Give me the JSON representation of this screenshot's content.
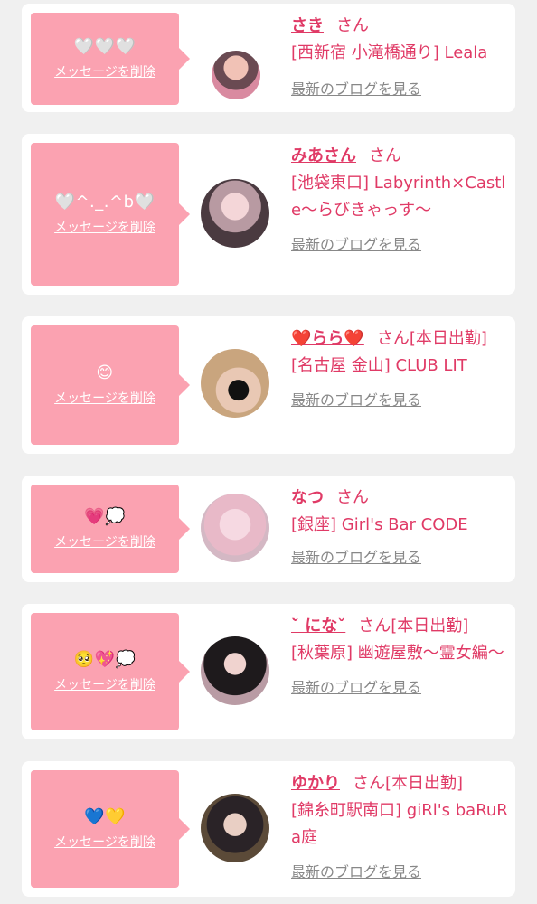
{
  "delete_label": "メッセージを削除",
  "blog_label": "最新のブログを見る",
  "san_label": "さん",
  "cards": [
    {
      "message": "🤍🤍🤍",
      "name": "さき",
      "suffix": "さん",
      "shop": "[西新宿 小滝橋通り] Leala"
    },
    {
      "message": "🤍^._.^b🤍",
      "name": "みあさん",
      "suffix": "さん",
      "shop": "[池袋東口] Labyrinth×Castle〜らびきゃっす〜"
    },
    {
      "message": "😊",
      "name": "❤️らら❤️",
      "suffix": "さん[本日出勤]",
      "shop": "[名古屋 金山] CLUB LIT"
    },
    {
      "message": "💗💭",
      "name": "なつ",
      "suffix": "さん",
      "shop": "[銀座] Girl's Bar CODE"
    },
    {
      "message": "🥺💖💭",
      "name": "˘̀ になˇ",
      "suffix": "さん[本日出勤]",
      "shop": "[秋葉原] 幽遊屋敷〜霊女編〜"
    },
    {
      "message": "💙💛",
      "name": "ゆかり",
      "suffix": "さん[本日出勤]",
      "shop": "[錦糸町駅南口] giRl's baRuRa庭"
    }
  ]
}
